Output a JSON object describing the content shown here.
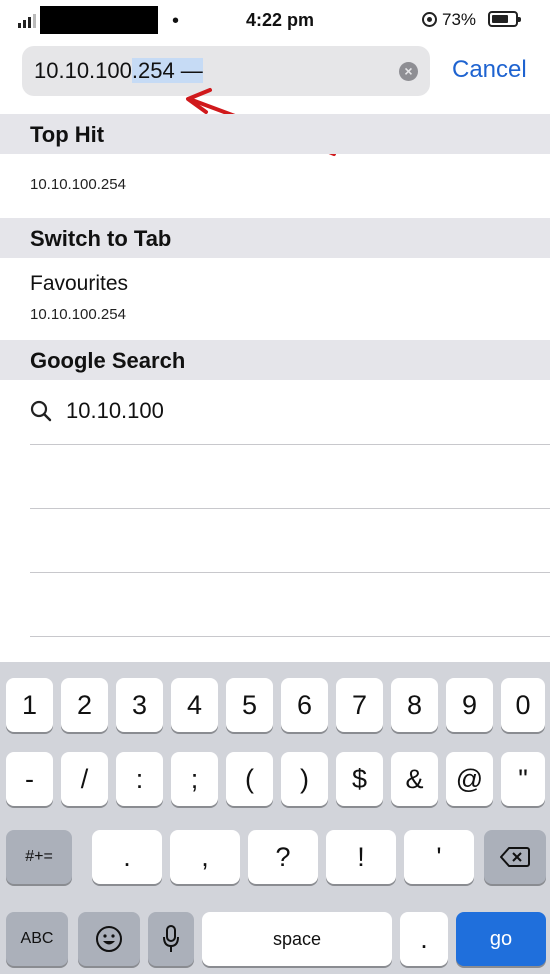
{
  "status_bar": {
    "time": "4:22 pm",
    "battery_percent": "73%",
    "icons": [
      "signal-icon",
      "rotation-lock-icon",
      "battery-icon"
    ]
  },
  "search": {
    "url_prefix": "10.10.100",
    "url_selected": ".254 —",
    "cancel_label": "Cancel"
  },
  "sections": {
    "top_hit": {
      "header": "Top Hit",
      "value": "10.10.100.254"
    },
    "switch_to_tab": {
      "header": "Switch to Tab",
      "title": "Favourites",
      "url": "10.10.100.254"
    },
    "google_search": {
      "header": "Google Search",
      "query": "10.10.100"
    }
  },
  "keyboard": {
    "row1": [
      "1",
      "2",
      "3",
      "4",
      "5",
      "6",
      "7",
      "8",
      "9",
      "0"
    ],
    "row2": [
      "-",
      "/",
      ":",
      ";",
      "(",
      ")",
      "$",
      "&",
      "@",
      "\""
    ],
    "row3": [
      "#+=",
      ".",
      ",",
      "?",
      "!",
      "'"
    ],
    "row4": {
      "abc": "ABC",
      "space": "space",
      "period": ".",
      "go": "go"
    }
  },
  "colors": {
    "accent": "#1e63d0",
    "section_bg": "#e5e5ea",
    "annotation": "#d0191c"
  }
}
